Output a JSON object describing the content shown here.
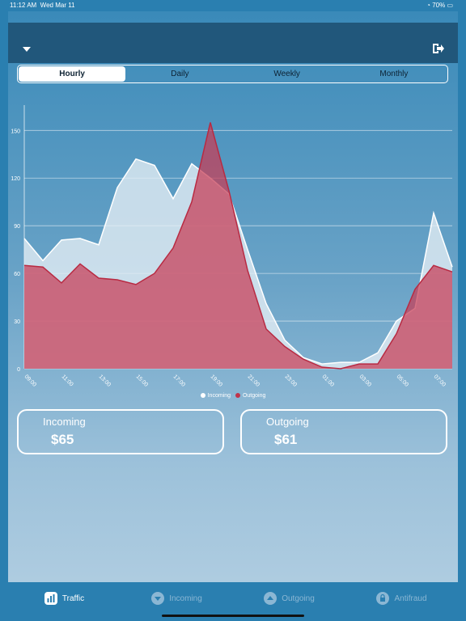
{
  "status_bar": {
    "time": "11:12 AM",
    "date": "Wed Mar 11",
    "battery": "70%"
  },
  "segments": [
    "Hourly",
    "Daily",
    "Weekly",
    "Monthly"
  ],
  "chart_data": {
    "type": "area",
    "x": [
      "09:00",
      "10:00",
      "11:00",
      "12:00",
      "13:00",
      "14:00",
      "15:00",
      "16:00",
      "17:00",
      "18:00",
      "19:00",
      "20:00",
      "21:00",
      "22:00",
      "23:00",
      "00:00",
      "01:00",
      "02:00",
      "03:00",
      "04:00",
      "05:00",
      "06:00",
      "07:00"
    ],
    "xticks": [
      "09:00",
      "11:00",
      "13:00",
      "15:00",
      "17:00",
      "19:00",
      "21:00",
      "23:00",
      "01:00",
      "03:00",
      "05:00",
      "07:00"
    ],
    "yticks": [
      0,
      30,
      60,
      90,
      120,
      150
    ],
    "ylim": [
      0,
      170
    ],
    "grid": true,
    "series": [
      {
        "name": "Incoming",
        "color": "#ffffff",
        "values": [
          82,
          68,
          81,
          82,
          78,
          114,
          132,
          128,
          107,
          129,
          120,
          110,
          75,
          41,
          18,
          7,
          3,
          4,
          4,
          10,
          30,
          38,
          98,
          64
        ]
      },
      {
        "name": "Outgoing",
        "color": "#c0334a",
        "values": [
          65,
          64,
          54,
          66,
          57,
          56,
          53,
          60,
          76,
          105,
          155,
          112,
          62,
          25,
          14,
          6,
          1,
          0,
          3,
          3,
          22,
          50,
          65,
          61
        ]
      }
    ]
  },
  "legend": {
    "incoming": "Incoming",
    "outgoing": "Outgoing"
  },
  "cards": {
    "incoming": {
      "label": "Incoming",
      "value": "$65"
    },
    "outgoing": {
      "label": "Outgoing",
      "value": "$61"
    }
  },
  "tabs": [
    "Traffic",
    "Incoming",
    "Outgoing",
    "Antifraud"
  ],
  "icons": [
    "chevron-down-icon",
    "logout-icon",
    "chart-bar-icon",
    "arrow-down-circle-icon",
    "arrow-up-circle-icon",
    "lock-icon"
  ]
}
